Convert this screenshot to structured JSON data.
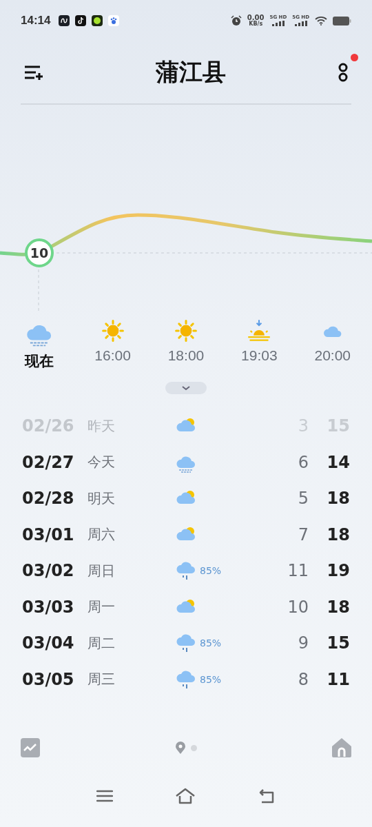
{
  "status_bar": {
    "time": "14:14",
    "speed": "0.00",
    "speed_unit": "KB/s",
    "networks": [
      "5G HD",
      "5G HD"
    ]
  },
  "header": {
    "title": "蒲江县",
    "notification": true
  },
  "chart": {
    "current": "10"
  },
  "hourly": [
    {
      "label": "现在",
      "kind": "fog",
      "selected": true
    },
    {
      "label": "16:00",
      "kind": "sun",
      "selected": false
    },
    {
      "label": "18:00",
      "kind": "sun",
      "selected": false
    },
    {
      "label": "19:03",
      "kind": "sunset",
      "selected": false
    },
    {
      "label": "20:00",
      "kind": "cloud",
      "selected": false
    }
  ],
  "daily": [
    {
      "date": "02/26",
      "day": "昨天",
      "kind": "partly",
      "low": "3",
      "high": "15",
      "past": true
    },
    {
      "date": "02/27",
      "day": "今天",
      "kind": "fog",
      "low": "6",
      "high": "14",
      "past": false
    },
    {
      "date": "02/28",
      "day": "明天",
      "kind": "partly",
      "low": "5",
      "high": "18",
      "past": false
    },
    {
      "date": "03/01",
      "day": "周六",
      "kind": "partly",
      "low": "7",
      "high": "18",
      "past": false
    },
    {
      "date": "03/02",
      "day": "周日",
      "kind": "rain",
      "precip": "85%",
      "low": "11",
      "high": "19",
      "past": false
    },
    {
      "date": "03/03",
      "day": "周一",
      "kind": "partly",
      "low": "10",
      "high": "18",
      "past": false
    },
    {
      "date": "03/04",
      "day": "周二",
      "kind": "rain",
      "precip": "85%",
      "low": "9",
      "high": "15",
      "past": false
    },
    {
      "date": "03/05",
      "day": "周三",
      "kind": "rain",
      "precip": "85%",
      "low": "8",
      "high": "11",
      "past": false
    }
  ],
  "pager": [
    {
      "kind": "location",
      "selected": true
    },
    {
      "kind": "dot",
      "selected": false
    }
  ]
}
